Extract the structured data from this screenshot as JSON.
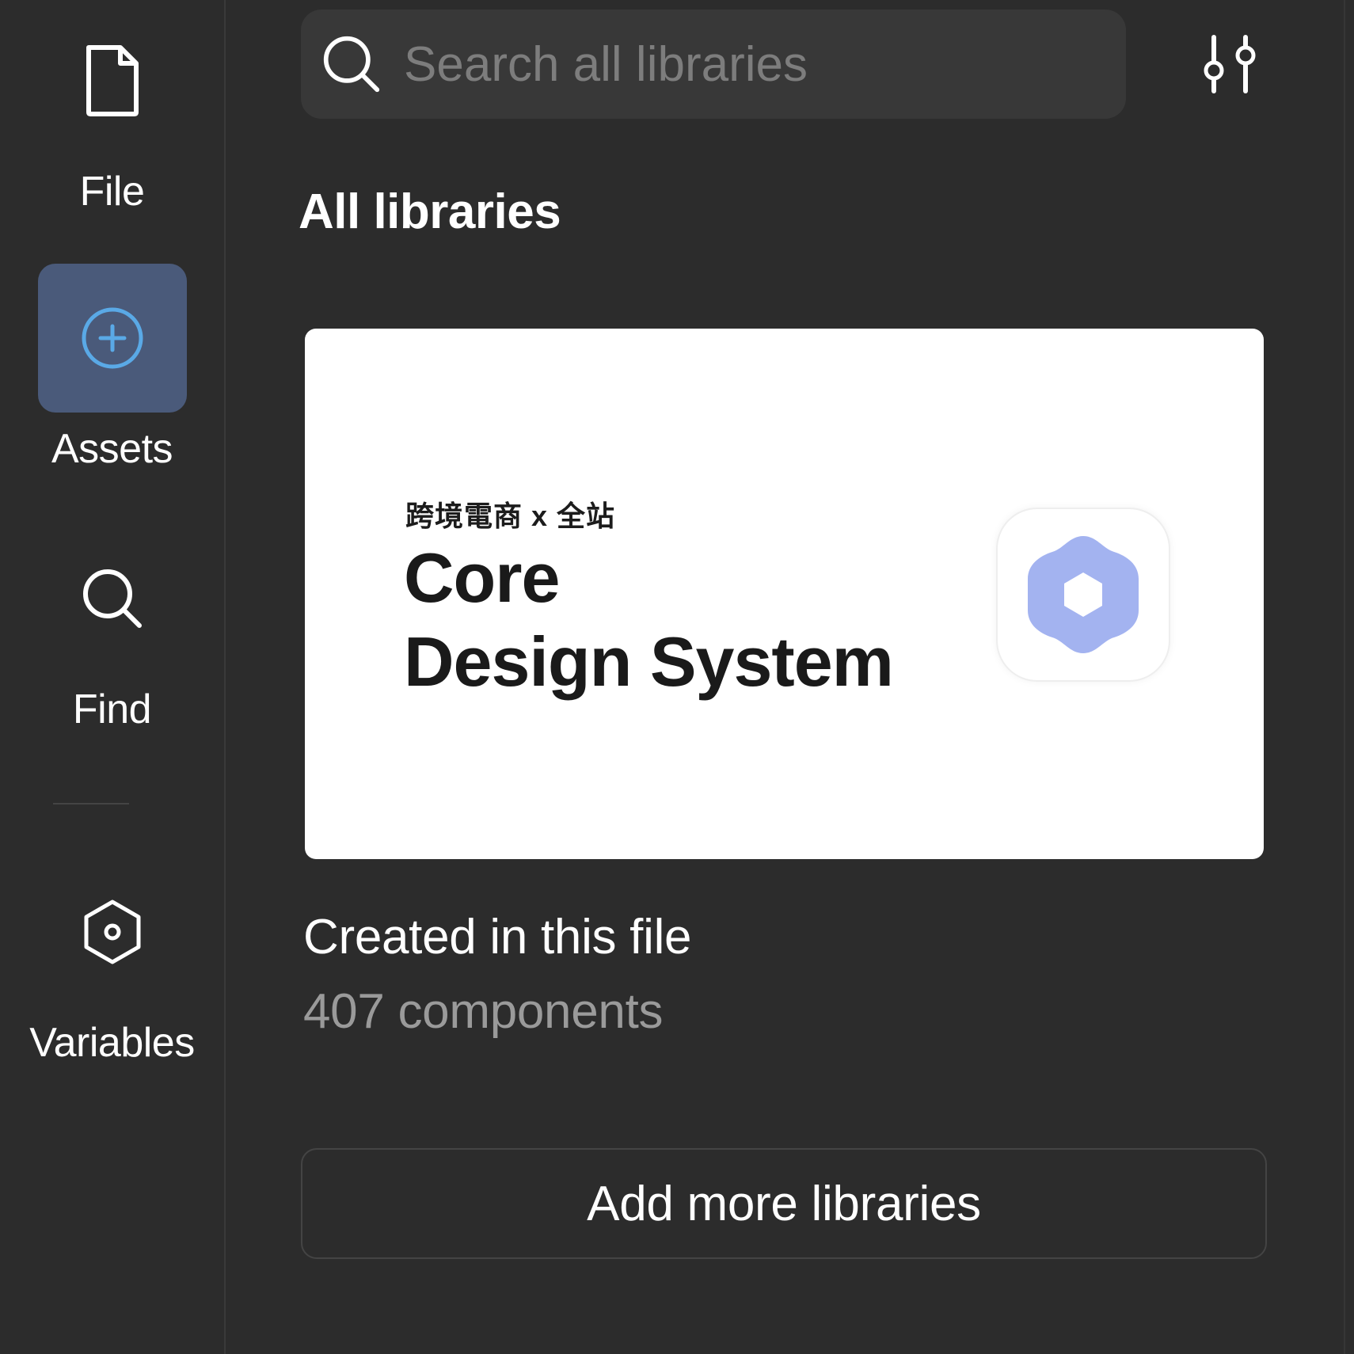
{
  "rail": {
    "items": [
      {
        "id": "file",
        "label": "File",
        "icon": "file-icon"
      },
      {
        "id": "assets",
        "label": "Assets",
        "icon": "add-circle-icon",
        "active": true
      },
      {
        "id": "find",
        "label": "Find",
        "icon": "search-icon"
      },
      {
        "id": "variables",
        "label": "Variables",
        "icon": "hexagon-icon"
      }
    ]
  },
  "search": {
    "placeholder": "Search all libraries",
    "value": ""
  },
  "section": {
    "title": "All libraries"
  },
  "library": {
    "card_subtitle": "跨境電商 x 全站",
    "card_title_line1": "Core",
    "card_title_line2": "Design System",
    "logo_color": "#a3b3f0",
    "name": "Created in this file",
    "count": "407 components"
  },
  "actions": {
    "add_more_label": "Add more libraries"
  },
  "colors": {
    "background": "#2c2c2c",
    "active_rail": "#4a5a7a",
    "accent": "#5aa9e6",
    "muted_text": "#9a9a9a"
  }
}
